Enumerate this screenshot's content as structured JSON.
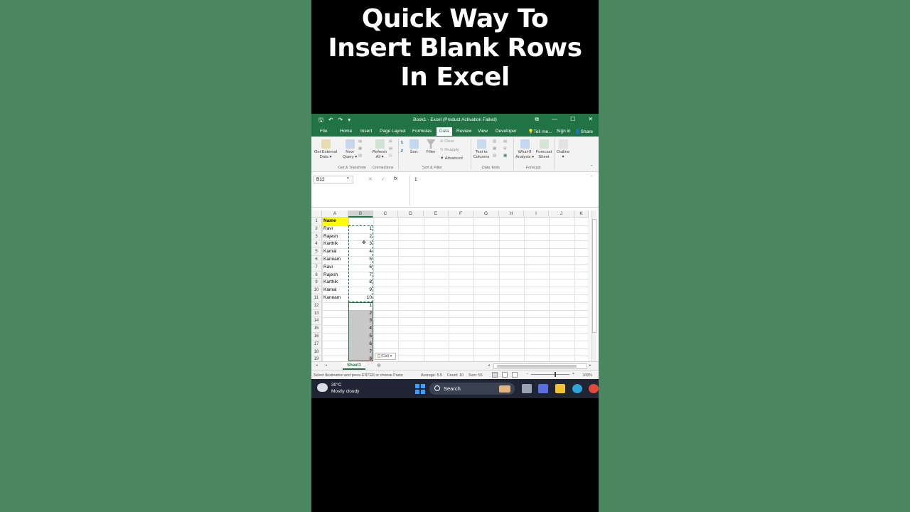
{
  "video_title": [
    "Quick Way To",
    "Insert Blank Rows",
    "In Excel"
  ],
  "window": {
    "title": "Book1 - Excel (Product Activation Failed)",
    "controls": [
      "⧉",
      "—",
      "☐",
      "✕"
    ],
    "qat": [
      "🖫",
      "↶",
      "↷",
      "▾"
    ]
  },
  "tabs": [
    "File",
    "Home",
    "Insert",
    "Page Layout",
    "Formulas",
    "Data",
    "Review",
    "View",
    "Developer"
  ],
  "active_tab": "Data",
  "tell_me": "Tell me...",
  "sign_in": "Sign in",
  "share": "Share",
  "ribbon": {
    "get_external": "Get External",
    "get_external2": "Data ▾",
    "new_query": "New",
    "new_query2": "Query ▾",
    "refresh": "Refresh",
    "refresh2": "All ▾",
    "sort": "Sort",
    "filter": "Filter",
    "clear": "Clear",
    "reapply": "Reapply",
    "advanced": "Advanced",
    "text_to_columns": "Text to",
    "text_to_columns2": "Columns",
    "what_if": "What-If",
    "what_if2": "Analysis ▾",
    "forecast_sheet": "Forecast",
    "forecast_sheet2": "Sheet",
    "outline": "Outline",
    "groups": [
      "Get & Transform",
      "Connections",
      "Sort & Filter",
      "Data Tools",
      "Forecast"
    ]
  },
  "formula_bar": {
    "name_box": "B12",
    "value": "1",
    "fx": "fx"
  },
  "columns": [
    "A",
    "B",
    "C",
    "D",
    "E",
    "F",
    "G",
    "H",
    "I",
    "J",
    "K"
  ],
  "selected_column": "B",
  "rows": [
    {
      "n": "1",
      "a": "Name",
      "b": ""
    },
    {
      "n": "2",
      "a": "Ravi",
      "b": "1"
    },
    {
      "n": "3",
      "a": "Rajesh",
      "b": "2"
    },
    {
      "n": "4",
      "a": "Karthik",
      "b": "3"
    },
    {
      "n": "5",
      "a": "Kamal",
      "b": "4"
    },
    {
      "n": "6",
      "a": "Kannam",
      "b": "5"
    },
    {
      "n": "7",
      "a": "Ravi",
      "b": "6"
    },
    {
      "n": "8",
      "a": "Rajesh",
      "b": "7"
    },
    {
      "n": "9",
      "a": "Karthik",
      "b": "8"
    },
    {
      "n": "10",
      "a": "Kamal",
      "b": "9"
    },
    {
      "n": "11",
      "a": "Kannam",
      "b": "10"
    },
    {
      "n": "12",
      "a": "",
      "b": "1"
    },
    {
      "n": "13",
      "a": "",
      "b": "2"
    },
    {
      "n": "14",
      "a": "",
      "b": "3"
    },
    {
      "n": "15",
      "a": "",
      "b": "4"
    },
    {
      "n": "16",
      "a": "",
      "b": "5"
    },
    {
      "n": "17",
      "a": "",
      "b": "6"
    },
    {
      "n": "18",
      "a": "",
      "b": "7"
    },
    {
      "n": "19",
      "a": "",
      "b": "8"
    }
  ],
  "paste_options": "(Ctrl) ▾",
  "sheet_tab": "Sheet1",
  "status": {
    "message": "Select destination and press ENTER or choose Paste",
    "average": "Average: 5.5",
    "count": "Count: 10",
    "sum": "Sum: 55",
    "zoom": "100%"
  },
  "taskbar": {
    "temp": "30°C",
    "weather": "Mostly cloudy",
    "search": "Search"
  },
  "colors": {
    "excel_green": "#217346",
    "highlight": "#ffff00",
    "background": "#4a8662"
  }
}
